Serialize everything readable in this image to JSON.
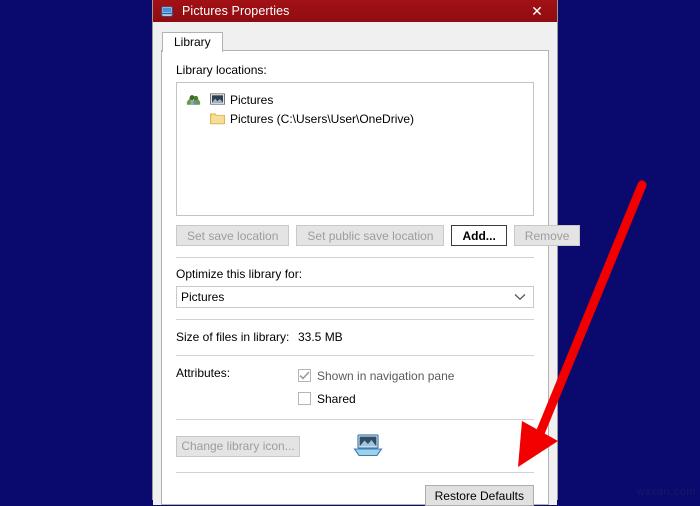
{
  "window": {
    "title": "Pictures Properties",
    "icon": "library-pictures-icon",
    "close_label": "✕",
    "titlebar_color": "#9c0d14"
  },
  "tabs": [
    {
      "label": "Library",
      "selected": true
    }
  ],
  "library_locations": {
    "label": "Library locations:",
    "group_icon": "pictures-library-icon",
    "items": [
      {
        "icon": "picture-icon",
        "label": "Pictures"
      },
      {
        "icon": "folder-icon",
        "label": "Pictures (C:\\Users\\User\\OneDrive)"
      }
    ]
  },
  "location_buttons": [
    {
      "label": "Set save location",
      "state": "disabled",
      "name": "set-save-location-button"
    },
    {
      "label": "Set public save location",
      "state": "disabled",
      "name": "set-public-save-location-button"
    },
    {
      "label": "Add...",
      "state": "focused",
      "name": "add-button"
    },
    {
      "label": "Remove",
      "state": "disabled",
      "name": "remove-button"
    }
  ],
  "optimize": {
    "label": "Optimize this library for:",
    "selected": "Pictures",
    "chevron": "chevron-down-icon"
  },
  "size": {
    "label": "Size of files in library:",
    "value": "33.5 MB"
  },
  "attributes": {
    "label": "Attributes:",
    "checkboxes": [
      {
        "label": "Shown in navigation pane",
        "checked": true,
        "disabled": true
      },
      {
        "label": "Shared",
        "checked": false,
        "disabled": false
      }
    ]
  },
  "bottom": {
    "change_icon_label": "Change library icon...",
    "change_icon_state": "disabled",
    "library_icon": "pictures-library-large-icon",
    "restore_label": "Restore Defaults"
  },
  "annotation": {
    "arrow": "red-arrow-pointing-to-restore-defaults",
    "color": "#f20000"
  },
  "watermark": {
    "text": "wsxdn.com"
  }
}
